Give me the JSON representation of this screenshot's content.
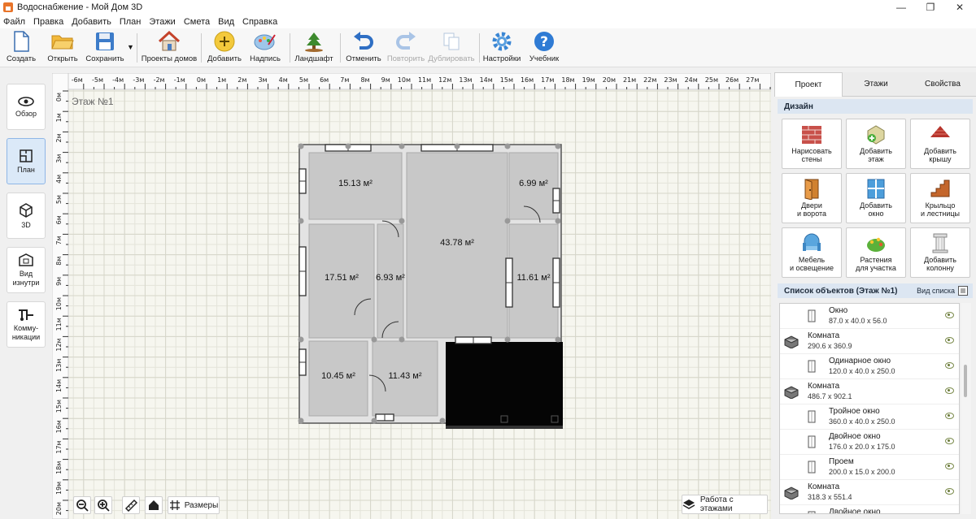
{
  "window": {
    "title": "Водоснабжение - Мой Дом 3D"
  },
  "menu": [
    "Файл",
    "Правка",
    "Добавить",
    "План",
    "Этажи",
    "Смета",
    "Вид",
    "Справка"
  ],
  "toolbar": {
    "create": "Создать",
    "open": "Открыть",
    "save": "Сохранить",
    "projects": "Проекты домов",
    "add": "Добавить",
    "label": "Надпись",
    "landscape": "Ландшафт",
    "undo": "Отменить",
    "redo": "Повторить",
    "duplicate": "Дублировать",
    "settings": "Настройки",
    "tutorial": "Учебник"
  },
  "left_nav": [
    {
      "label": "Обзор",
      "icon": "eye-icon"
    },
    {
      "label": "План",
      "icon": "plan-icon",
      "active": true
    },
    {
      "label": "3D",
      "icon": "cube-icon"
    },
    {
      "label": "Вид\nизнутри",
      "icon": "interior-view-icon"
    },
    {
      "label": "Комму-\nникации",
      "icon": "pipes-icon"
    }
  ],
  "canvas": {
    "floor_label": "Этаж №1",
    "ruler_x": [
      "-6м",
      "-5м",
      "-4м",
      "-3м",
      "-2м",
      "-1м",
      "0м",
      "1м",
      "2м",
      "3м",
      "4м",
      "5м",
      "6м",
      "7м",
      "8м",
      "9м",
      "10м",
      "11м",
      "12м",
      "13м",
      "14м",
      "15м",
      "16м",
      "17м",
      "18м",
      "19м",
      "20м",
      "21м",
      "22м",
      "23м",
      "24м",
      "25м",
      "26м",
      "27м"
    ],
    "ruler_y": [
      "0м",
      "1м",
      "2м",
      "3м",
      "4м",
      "5м",
      "6м",
      "7м",
      "8м",
      "9м",
      "10м",
      "11м",
      "12м",
      "13м",
      "14м",
      "15м",
      "16м",
      "17м",
      "18м",
      "19м",
      "20м"
    ],
    "rooms": [
      "15.13 м²",
      "43.78 м²",
      "6.99 м²",
      "17.51 м²",
      "6.93 м²",
      "11.61 м²",
      "10.45 м²",
      "11.43 м²"
    ]
  },
  "bottom": {
    "sizes": "Размеры",
    "floors": "Работа с этажами"
  },
  "right": {
    "tabs": [
      "Проект",
      "Этажи",
      "Свойства"
    ],
    "design_title": "Дизайн",
    "design_buttons": [
      "Нарисовать\nстены",
      "Добавить\nэтаж",
      "Добавить\nкрышу",
      "Двери\nи ворота",
      "Добавить\nокно",
      "Крыльцо\nи лестницы",
      "Мебель\nи освещение",
      "Растения\nдля участка",
      "Добавить\nколонну"
    ],
    "objects_title": "Список объектов (Этаж №1)",
    "list_view": "Вид списка",
    "objects": [
      {
        "name": "Окно",
        "size": "87.0 x 40.0 x 56.0",
        "indent": true
      },
      {
        "name": "Комната",
        "size": "290.6 x 360.9",
        "indent": false
      },
      {
        "name": "Одинарное окно",
        "size": "120.0 x 40.0 x 250.0",
        "indent": true
      },
      {
        "name": "Комната",
        "size": "486.7 x 902.1",
        "indent": false
      },
      {
        "name": "Тройное окно",
        "size": "360.0 x 40.0 x 250.0",
        "indent": true
      },
      {
        "name": "Двойное окно",
        "size": "176.0 x 20.0 x 175.0",
        "indent": true
      },
      {
        "name": "Проем",
        "size": "200.0 x 15.0 x 200.0",
        "indent": true
      },
      {
        "name": "Комната",
        "size": "318.3 x 551.4",
        "indent": false
      },
      {
        "name": "Двойное окно",
        "size": "",
        "indent": true
      }
    ]
  }
}
